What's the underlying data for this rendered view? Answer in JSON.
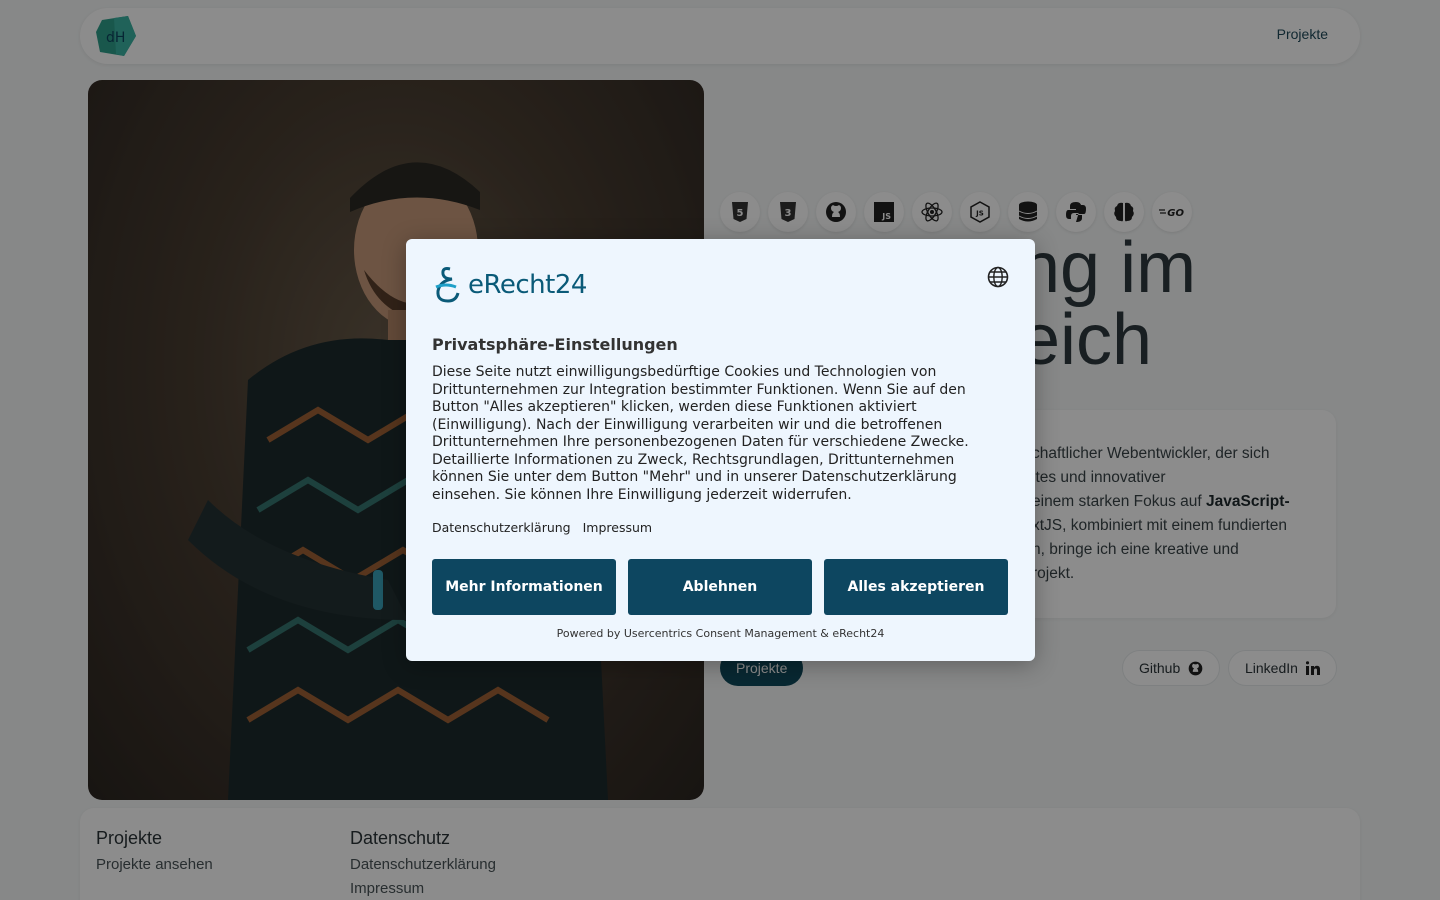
{
  "header": {
    "logo_text": "dH",
    "nav": {
      "projects": "Projekte"
    }
  },
  "hero": {
    "tech_icons": [
      {
        "name": "html5-icon",
        "glyph": "5"
      },
      {
        "name": "css3-icon",
        "glyph": "3"
      },
      {
        "name": "github-icon",
        "glyph": ""
      },
      {
        "name": "javascript-icon",
        "glyph": "JS"
      },
      {
        "name": "react-icon",
        "glyph": "⚛"
      },
      {
        "name": "nodejs-icon",
        "glyph": "JS"
      },
      {
        "name": "database-icon",
        "glyph": ""
      },
      {
        "name": "python-icon",
        "glyph": ""
      },
      {
        "name": "brain-icon",
        "glyph": ""
      },
      {
        "name": "golang-icon",
        "glyph": "GO"
      }
    ],
    "title_line1": "ng im",
    "title_line2": "eich",
    "about": {
      "l1": "chaftlicher Webentwickler, der sich",
      "l2": "ites und innovativer",
      "l3a": "einem starken Fokus auf ",
      "l3b": "JavaScript-",
      "l4": "xtJS, kombiniert mit einem fundierten",
      "l5": "n, bringe ich eine kreative und",
      "l6": "rojekt."
    },
    "buttons": {
      "projects": "Projekte",
      "github": "Github",
      "linkedin": "LinkedIn"
    }
  },
  "footer": {
    "col1": {
      "title": "Projekte",
      "link1": "Projekte ansehen"
    },
    "col2": {
      "title": "Datenschutz",
      "link1": "Datenschutzerklärung",
      "link2": "Impressum"
    }
  },
  "consent": {
    "brand": "eRecht24",
    "title": "Privatsphäre-Einstellungen",
    "description": "Diese Seite nutzt einwilligungsbedürftige Cookies und Technologien von Drittunternehmen zur Integration bestimmter Funktionen. Wenn Sie auf den Button \"Alles akzeptieren\" klicken, werden diese Funktionen aktiviert (Einwilligung). Nach der Einwilligung verarbeiten wir und die betroffenen Drittunternehmen Ihre personenbezogenen Daten für verschiedene Zwecke. Detaillierte Informationen zu Zweck, Rechtsgrundlagen, Drittunternehmen können Sie unter dem Button \"Mehr\" und in unserer Datenschutzerklärung einsehen. Sie können Ihre Einwilligung jederzeit widerrufen.",
    "links": {
      "privacy": "Datenschutzerklärung",
      "imprint": "Impressum"
    },
    "buttons": {
      "more": "Mehr Informationen",
      "decline": "Ablehnen",
      "accept": "Alles akzeptieren"
    },
    "powered_by": "Powered by Usercentrics Consent Management & eRecht24"
  },
  "colors": {
    "accent": "#0d4660",
    "brand": "#0a5a78",
    "modal_bg": "#eef6fe"
  }
}
